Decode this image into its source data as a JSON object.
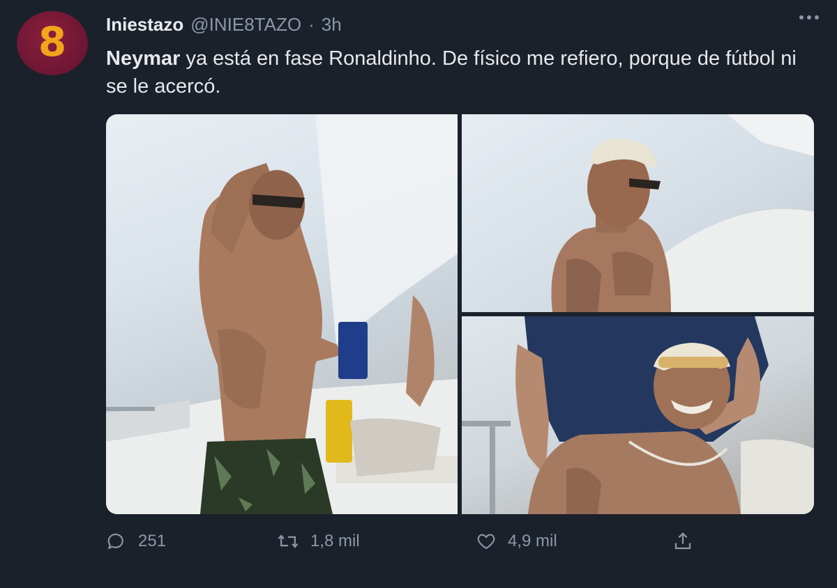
{
  "tweet": {
    "avatar_icon": "galatasaray-8-logo",
    "display_name": "Iniestazo",
    "handle": "@INIE8TAZO",
    "separator": "·",
    "time": "3h",
    "text_mention": "Neymar",
    "text_body": " ya está en fase Ronaldinho. De físico me refiero, porque de fútbol ni se le acercó."
  },
  "media": {
    "photos": [
      "photo-1",
      "photo-2",
      "photo-3"
    ]
  },
  "actions": {
    "reply_count": "251",
    "retweet_count": "1,8 mil",
    "like_count": "4,9 mil"
  },
  "colors": {
    "background": "#1b212b",
    "muted": "#8b98a5",
    "avatar": "#6d1633",
    "avatar_glyph": "#f2a51a"
  }
}
